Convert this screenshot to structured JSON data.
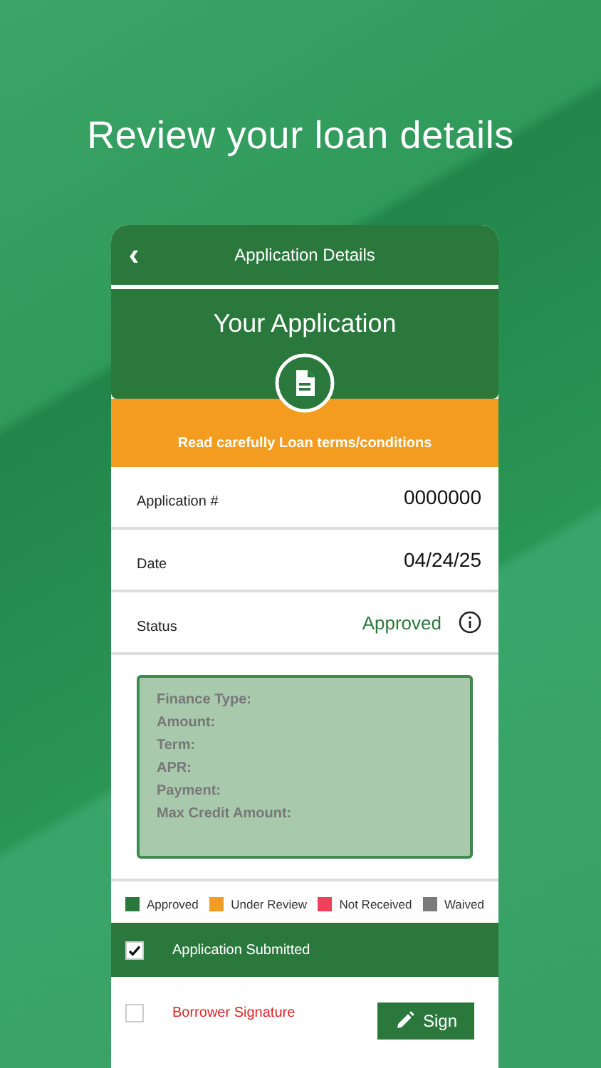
{
  "headline": "Review your loan details",
  "app_bar": {
    "back": "‹",
    "title": "Application Details"
  },
  "hero": {
    "title": "Your Application"
  },
  "notice": "Read carefully Loan terms/conditions",
  "fields": [
    {
      "label": "Application #",
      "value": "0000000",
      "kind": "plain"
    },
    {
      "label": "Date",
      "value": "04/24/25",
      "kind": "plain"
    },
    {
      "label": "Status",
      "value": "Approved",
      "kind": "status",
      "color": "#2a783c"
    }
  ],
  "summary": [
    "Finance Type:",
    "Amount:",
    "Term:",
    "APR:",
    "Payment:",
    "Max Credit Amount:"
  ],
  "legend": [
    {
      "label": "Approved",
      "color": "#2a783c"
    },
    {
      "label": "Under Review",
      "color": "#f39c1f"
    },
    {
      "label": "Not Received",
      "color": "#f0405a"
    },
    {
      "label": "Waived",
      "color": "#7a7a7a"
    }
  ],
  "tasks": [
    {
      "label": "Application Submitted",
      "checked": true,
      "color": "#2a783c"
    },
    {
      "label": "Borrower Signature",
      "checked": false,
      "color": "#e02424",
      "action": "Sign"
    }
  ]
}
